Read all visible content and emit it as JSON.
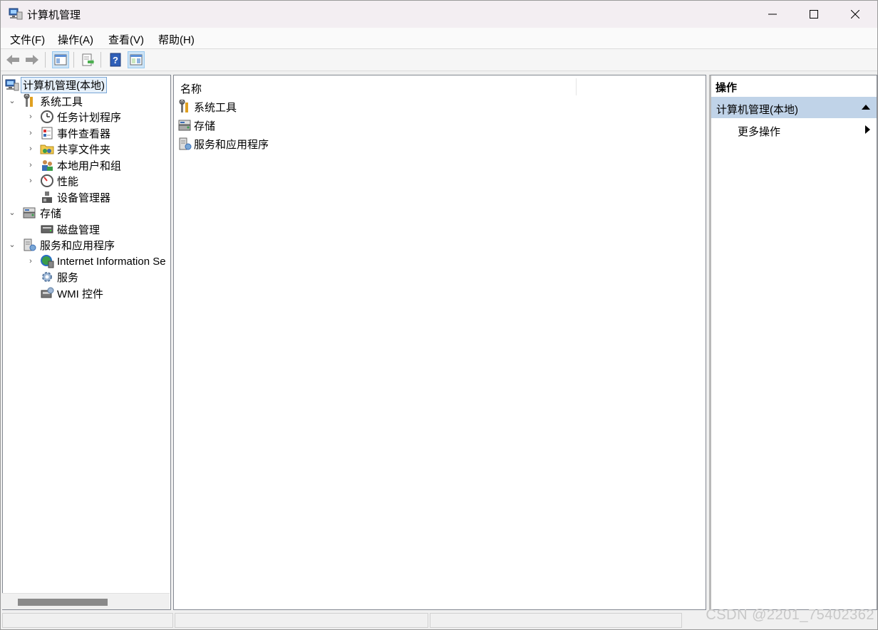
{
  "window": {
    "title": "计算机管理"
  },
  "menu": [
    {
      "label": "文件(F)"
    },
    {
      "label": "操作(A)"
    },
    {
      "label": "查看(V)"
    },
    {
      "label": "帮助(H)"
    }
  ],
  "toolbar": {
    "items": [
      "back-icon",
      "forward-icon",
      "show-hide-tree-icon",
      "export-list-icon",
      "help-icon",
      "show-hide-action-pane-icon"
    ]
  },
  "tree": {
    "root": "计算机管理(本地)",
    "items": [
      {
        "label": "系统工具",
        "level": 1,
        "expander": "expanded"
      },
      {
        "label": "任务计划程序",
        "level": 2,
        "expander": "collapsed"
      },
      {
        "label": "事件查看器",
        "level": 2,
        "expander": "collapsed"
      },
      {
        "label": "共享文件夹",
        "level": 2,
        "expander": "collapsed"
      },
      {
        "label": "本地用户和组",
        "level": 2,
        "expander": "collapsed"
      },
      {
        "label": "性能",
        "level": 2,
        "expander": "collapsed"
      },
      {
        "label": "设备管理器",
        "level": 2,
        "expander": "none"
      },
      {
        "label": "存储",
        "level": 1,
        "expander": "expanded"
      },
      {
        "label": "磁盘管理",
        "level": 2,
        "expander": "none"
      },
      {
        "label": "服务和应用程序",
        "level": 1,
        "expander": "expanded"
      },
      {
        "label": "Internet Information Se",
        "level": 2,
        "expander": "collapsed"
      },
      {
        "label": "服务",
        "level": 2,
        "expander": "none"
      },
      {
        "label": "WMI 控件",
        "level": 2,
        "expander": "none"
      }
    ]
  },
  "list": {
    "column_header": "名称",
    "items": [
      {
        "label": "系统工具"
      },
      {
        "label": "存储"
      },
      {
        "label": "服务和应用程序"
      }
    ]
  },
  "actions": {
    "title": "操作",
    "section": "计算机管理(本地)",
    "items": [
      {
        "label": "更多操作"
      }
    ]
  },
  "watermark": "CSDN @2201_75402362"
}
